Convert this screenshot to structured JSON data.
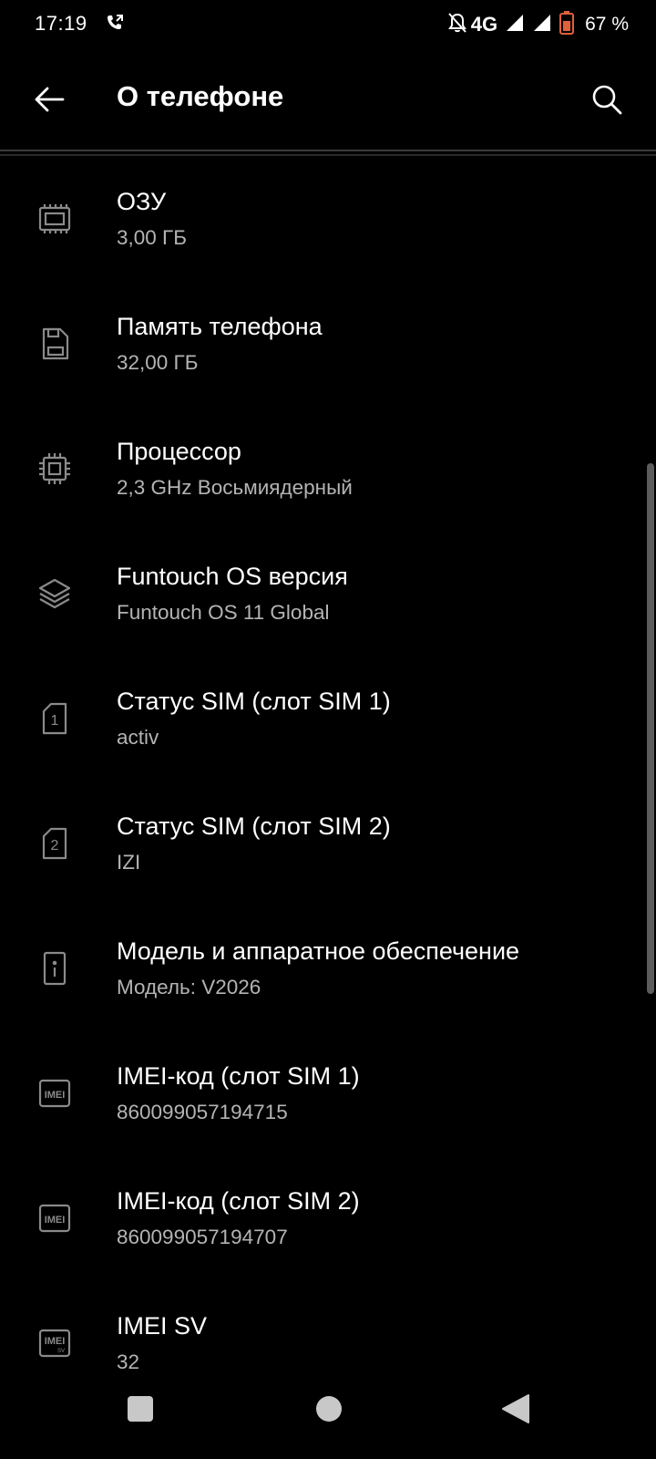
{
  "status_bar": {
    "time": "17:19",
    "network": "4G",
    "battery_text": "67 %",
    "battery_color": "#e0603c",
    "icons": [
      "call-forward-icon",
      "bell-off-icon",
      "signal-icon",
      "signal-icon",
      "battery-icon"
    ]
  },
  "app_bar": {
    "title": "О телефоне",
    "back_icon": "arrow-left-icon",
    "search_icon": "search-icon"
  },
  "items": [
    {
      "title": "ОЗУ",
      "subtitle": "3,00 ГБ",
      "icon": "memory-chip-icon"
    },
    {
      "title": "Память телефона",
      "subtitle": "32,00 ГБ",
      "icon": "sd-card-icon"
    },
    {
      "title": "Процессор",
      "subtitle": "2,3 GHz Восьмиядерный",
      "icon": "cpu-icon"
    },
    {
      "title": "Funtouch OS версия",
      "subtitle": "Funtouch OS 11 Global",
      "icon": "layers-icon"
    },
    {
      "title": "Статус SIM (слот SIM 1)",
      "subtitle": "activ",
      "icon": "sim-1-icon"
    },
    {
      "title": "Статус SIM (слот SIM 2)",
      "subtitle": "IZI",
      "icon": "sim-2-icon"
    },
    {
      "title": "Модель и аппаратное обеспечение",
      "subtitle": "Модель: V2026",
      "icon": "phone-info-icon"
    },
    {
      "title": "IMEI-код (слот SIM 1)",
      "subtitle": "860099057194715",
      "icon": "imei-icon"
    },
    {
      "title": "IMEI-код (слот SIM 2)",
      "subtitle": "860099057194707",
      "icon": "imei-icon"
    },
    {
      "title": "IMEI SV",
      "subtitle": "32",
      "icon": "imei-sv-icon"
    }
  ],
  "icon_labels": {
    "imei": "IMEI",
    "imei_sv_sub": "SV",
    "sim1": "1",
    "sim2": "2"
  },
  "nav_bar": {
    "icons": [
      "recents-icon",
      "home-icon",
      "back-icon"
    ]
  },
  "colors": {
    "background": "#000000",
    "primary_text": "#ffffff",
    "secondary_text": "#b4b4b4",
    "icon": "#8a8a8a"
  }
}
